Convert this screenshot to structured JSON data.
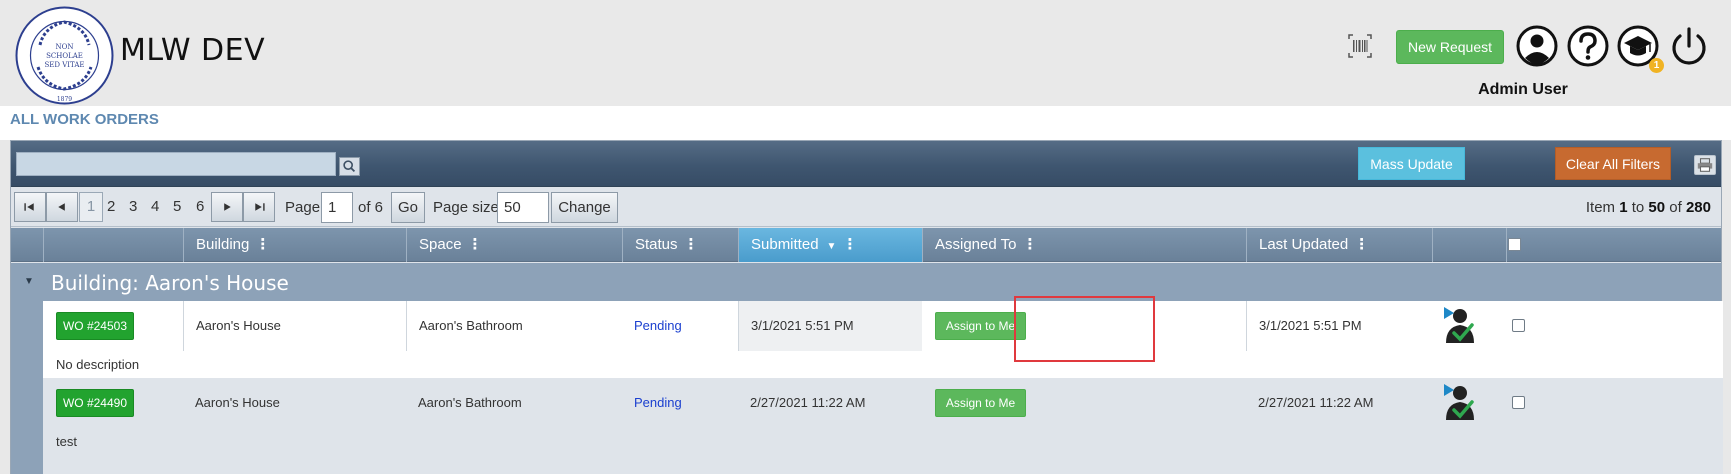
{
  "header": {
    "app_title": "MLW DEV",
    "new_request_label": "New Request",
    "user_name": "Admin User",
    "notification_count": "1",
    "logo_text": {
      "arc": "CAMDEN CENTRAL SCHOOL DISTRICT",
      "line1": "NON",
      "line2": "SCHOLAE",
      "line3": "SED VITAE",
      "year": "1879"
    },
    "icons": [
      "barcode-icon",
      "user-profile-icon",
      "help-icon",
      "graduation-cap-icon",
      "power-icon"
    ]
  },
  "page": {
    "title": "ALL WORK ORDERS"
  },
  "toolbar": {
    "search_value": "",
    "mass_update_label": "Mass Update",
    "clear_filters_label": "Clear All Filters"
  },
  "pager": {
    "pages": [
      "1",
      "2",
      "3",
      "4",
      "5",
      "6"
    ],
    "current_page": "1",
    "page_label": "Page:",
    "page_input": "1",
    "of_label": "of 6",
    "go_label": "Go",
    "page_size_label": "Page size:",
    "page_size_value": "50",
    "change_label": "Change",
    "summary": {
      "prefix": "Item",
      "from": "1",
      "to_word": "to",
      "to": "50",
      "of_word": "of",
      "total": "280"
    }
  },
  "columns": {
    "building": "Building",
    "space": "Space",
    "status": "Status",
    "submitted": "Submitted",
    "assigned_to": "Assigned To",
    "last_updated": "Last Updated"
  },
  "group": {
    "label": "Building: Aaron's House"
  },
  "rows": [
    {
      "wo": "WO #24503",
      "building": "Aaron's House",
      "space": "Aaron's Bathroom",
      "status": "Pending",
      "submitted": "3/1/2021 5:51 PM",
      "assign_label": "Assign to Me",
      "last_updated": "3/1/2021 5:51 PM",
      "description": "No description"
    },
    {
      "wo": "WO #24490",
      "building": "Aaron's House",
      "space": "Aaron's Bathroom",
      "status": "Pending",
      "submitted": "2/27/2021 11:22 AM",
      "assign_label": "Assign to Me",
      "last_updated": "2/27/2021 11:22 AM",
      "description": "test"
    }
  ],
  "colors": {
    "success": "#5cb85c",
    "info": "#5bc0de",
    "warning": "#c76a30",
    "pending": "#1a3fcf",
    "highlight": "#e0393e"
  }
}
